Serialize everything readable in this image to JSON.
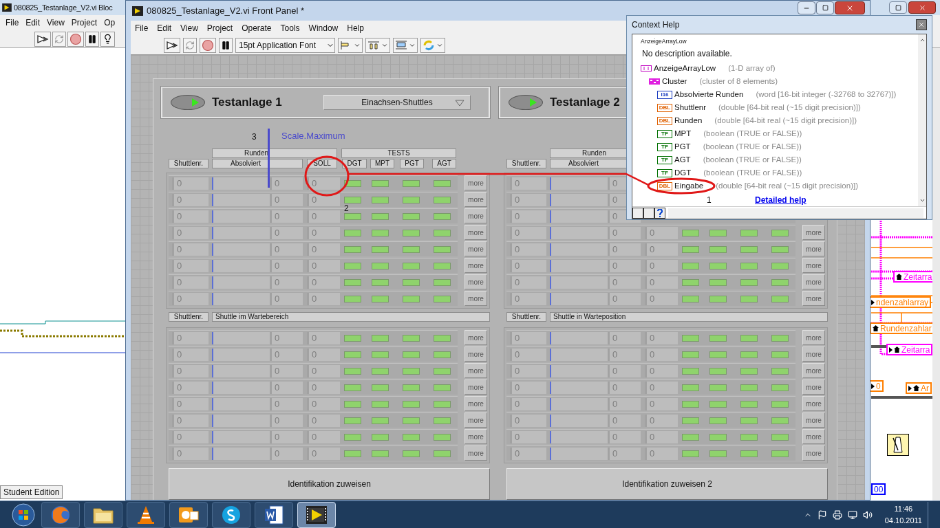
{
  "block_diagram": {
    "title": "080825_Testanlage_V2.vi Bloc",
    "menu": [
      "File",
      "Edit",
      "View",
      "Project",
      "Op"
    ],
    "status": "Student Edition",
    "nodes": [
      {
        "text": "Zeitarra",
        "color": "#ff00ff",
        "arrow": false,
        "home": true
      },
      {
        "text": "ndenzahlarray",
        "color": "#ff7f00",
        "arrow": true,
        "home": false
      },
      {
        "text": "Rundenzahlar",
        "color": "#ff7f00",
        "arrow": false,
        "home": true
      },
      {
        "text": "Zeitarra",
        "color": "#ff00ff",
        "arrow": true,
        "home": true
      },
      {
        "text": "0",
        "color": "#ff7f00",
        "arrow": true,
        "home": false
      },
      {
        "text": "Ar",
        "color": "#ff7f00",
        "arrow": true,
        "home": true
      },
      {
        "text": "00",
        "color": "#0000ff",
        "arrow": false,
        "home": false
      }
    ]
  },
  "front_panel": {
    "title": "080825_Testanlage_V2.vi Front Panel *",
    "menu": [
      "File",
      "Edit",
      "View",
      "Project",
      "Operate",
      "Tools",
      "Window",
      "Help"
    ],
    "font": "15pt Application Font",
    "sections": [
      {
        "title": "Testanlage 1",
        "on": true,
        "dropdown": "Einachsen-Shuttles",
        "headers": {
          "shuttle": "Shuttlenr.",
          "runden": "Runden",
          "absolviert": "Absolviert",
          "soll": "SOLL",
          "tests": "TESTS",
          "test_columns": [
            "DGT",
            "MPT",
            "PGT",
            "AGT"
          ]
        },
        "rows": [
          {
            "shuttle": "0",
            "level": 0,
            "count": "0",
            "soll": "0",
            "leds": [
              true,
              true,
              true,
              true
            ],
            "more": "more"
          },
          {
            "shuttle": "0",
            "level": 0,
            "count": "0",
            "soll": "0",
            "leds": [
              true,
              true,
              true,
              true
            ],
            "more": "more"
          },
          {
            "shuttle": "0",
            "level": 0,
            "count": "0",
            "soll": "0",
            "leds": [
              true,
              true,
              true,
              true
            ],
            "more": "more"
          },
          {
            "shuttle": "0",
            "level": 0,
            "count": "0",
            "soll": "0",
            "leds": [
              true,
              true,
              true,
              true
            ],
            "more": "more"
          },
          {
            "shuttle": "0",
            "level": 0,
            "count": "0",
            "soll": "0",
            "leds": [
              true,
              true,
              true,
              true
            ],
            "more": "more"
          },
          {
            "shuttle": "0",
            "level": 0,
            "count": "0",
            "soll": "0",
            "leds": [
              true,
              true,
              true,
              true
            ],
            "more": "more"
          },
          {
            "shuttle": "0",
            "level": 0,
            "count": "0",
            "soll": "0",
            "leds": [
              true,
              true,
              true,
              true
            ],
            "more": "more"
          },
          {
            "shuttle": "0",
            "level": 0,
            "count": "0",
            "soll": "0",
            "leds": [
              true,
              true,
              true,
              true
            ],
            "more": "more"
          }
        ],
        "wait_labels": {
          "shuttle": "Shuttlenr.",
          "area": "Shuttle im Wartebereich"
        },
        "wait_rows": [
          {
            "shuttle": "0",
            "level": 0,
            "count": "0",
            "soll": "0",
            "leds": [
              true,
              true,
              true,
              true
            ],
            "more": "more"
          },
          {
            "shuttle": "0",
            "level": 0,
            "count": "0",
            "soll": "0",
            "leds": [
              true,
              true,
              true,
              true
            ],
            "more": "more"
          },
          {
            "shuttle": "0",
            "level": 0,
            "count": "0",
            "soll": "0",
            "leds": [
              true,
              true,
              true,
              true
            ],
            "more": "more"
          },
          {
            "shuttle": "0",
            "level": 0,
            "count": "0",
            "soll": "0",
            "leds": [
              true,
              true,
              true,
              true
            ],
            "more": "more"
          },
          {
            "shuttle": "0",
            "level": 0,
            "count": "0",
            "soll": "0",
            "leds": [
              true,
              true,
              true,
              true
            ],
            "more": "more"
          },
          {
            "shuttle": "0",
            "level": 0,
            "count": "0",
            "soll": "0",
            "leds": [
              true,
              true,
              true,
              true
            ],
            "more": "more"
          },
          {
            "shuttle": "0",
            "level": 0,
            "count": "0",
            "soll": "0",
            "leds": [
              true,
              true,
              true,
              true
            ],
            "more": "more"
          },
          {
            "shuttle": "0",
            "level": 0,
            "count": "0",
            "soll": "0",
            "leds": [
              true,
              true,
              true,
              true
            ],
            "more": "more"
          }
        ],
        "button": "Identifikation zuweisen"
      },
      {
        "title": "Testanlage 2",
        "on": true,
        "headers": {
          "shuttle": "Shuttlenr.",
          "runden": "Runden",
          "absolviert": "Absolviert"
        },
        "rows": [
          {
            "shuttle": "0",
            "level": 0,
            "count": "0"
          },
          {
            "shuttle": "0",
            "level": 0,
            "count": "0"
          },
          {
            "shuttle": "0",
            "level": 0,
            "count": "0"
          },
          {
            "shuttle": "0",
            "level": 0,
            "count": "0",
            "soll": "0",
            "leds": [
              true,
              true,
              true,
              true
            ],
            "more": "more"
          },
          {
            "shuttle": "0",
            "level": 0,
            "count": "0",
            "soll": "0",
            "leds": [
              true,
              true,
              true,
              true
            ],
            "more": "more"
          },
          {
            "shuttle": "0",
            "level": 0,
            "count": "0",
            "soll": "0",
            "leds": [
              true,
              true,
              true,
              true
            ],
            "more": "more"
          },
          {
            "shuttle": "0",
            "level": 0,
            "count": "0",
            "soll": "0",
            "leds": [
              true,
              true,
              true,
              true
            ],
            "more": "more"
          },
          {
            "shuttle": "0",
            "level": 0,
            "count": "0",
            "soll": "0",
            "leds": [
              true,
              true,
              true,
              true
            ],
            "more": "more"
          }
        ],
        "wait_labels": {
          "shuttle": "Shuttlenr.",
          "area": "Shuttle in Warteposition"
        },
        "wait_rows": [
          {
            "shuttle": "0",
            "level": 0,
            "count": "0",
            "soll": "0",
            "leds": [
              true,
              true,
              true,
              true
            ],
            "more": "more"
          },
          {
            "shuttle": "0",
            "level": 0,
            "count": "0",
            "soll": "0",
            "leds": [
              true,
              true,
              true,
              true
            ],
            "more": "more"
          },
          {
            "shuttle": "0",
            "level": 0,
            "count": "0",
            "soll": "0",
            "leds": [
              true,
              true,
              true,
              true
            ],
            "more": "more"
          },
          {
            "shuttle": "0",
            "level": 0,
            "count": "0",
            "soll": "0",
            "leds": [
              true,
              true,
              true,
              true
            ],
            "more": "more"
          },
          {
            "shuttle": "0",
            "level": 0,
            "count": "0",
            "soll": "0",
            "leds": [
              true,
              true,
              true,
              true
            ],
            "more": "more"
          },
          {
            "shuttle": "0",
            "level": 0,
            "count": "0",
            "soll": "0",
            "leds": [
              true,
              true,
              true,
              true
            ],
            "more": "more"
          },
          {
            "shuttle": "0",
            "level": 0,
            "count": "0",
            "soll": "0",
            "leds": [
              true,
              true,
              true,
              true
            ],
            "more": "more"
          },
          {
            "shuttle": "0",
            "level": 0,
            "count": "0",
            "soll": "0",
            "leds": [
              true,
              true,
              true,
              true
            ],
            "more": "more"
          }
        ],
        "button": "Identifikation zuweisen 2"
      }
    ]
  },
  "context_help": {
    "title": "Context Help",
    "name": "AnzeigeArrayLow",
    "description": "No description available.",
    "tree": [
      {
        "kind": "array",
        "name": "AnzeigeArrayLow",
        "type": "(1-D array of)",
        "children": [
          {
            "kind": "cluster",
            "name": "Cluster",
            "type": "(cluster of 8 elements)",
            "children": [
              {
                "kind": "i16",
                "tag": "I16",
                "name": "Absolvierte Runden",
                "type": "(word [16-bit integer (-32768 to 32767)])"
              },
              {
                "kind": "dbl",
                "tag": "DBL",
                "name": "Shuttlenr",
                "type": "(double [64-bit real (~15 digit precision)])"
              },
              {
                "kind": "dbl",
                "tag": "DBL",
                "name": "Runden",
                "type": "(double [64-bit real (~15 digit precision)])"
              },
              {
                "kind": "tf",
                "tag": "TF",
                "name": "MPT",
                "type": "(boolean (TRUE or FALSE))"
              },
              {
                "kind": "tf",
                "tag": "TF",
                "name": "PGT",
                "type": "(boolean (TRUE or FALSE))"
              },
              {
                "kind": "tf",
                "tag": "TF",
                "name": "AGT",
                "type": "(boolean (TRUE or FALSE))"
              },
              {
                "kind": "tf",
                "tag": "TF",
                "name": "DGT",
                "type": "(boolean (TRUE or FALSE))"
              },
              {
                "kind": "dbl",
                "tag": "DBL",
                "name": "Eingabe",
                "type": "(double [64-bit real (~15 digit precision)])"
              }
            ]
          }
        ]
      }
    ],
    "link": "Detailed help"
  },
  "annotations": {
    "scale_label": "Scale.Maximum",
    "markers": [
      "1",
      "2",
      "3"
    ]
  },
  "taskbar": {
    "apps": [
      {
        "kind": "browser",
        "selected": false
      },
      {
        "kind": "folder",
        "selected": false
      },
      {
        "kind": "cone",
        "selected": false
      },
      {
        "kind": "mail",
        "selected": false
      },
      {
        "kind": "chat",
        "selected": false
      },
      {
        "kind": "document",
        "selected": false
      },
      {
        "kind": "film",
        "selected": true
      }
    ],
    "time": "11:46",
    "date": "04.10.2011"
  }
}
